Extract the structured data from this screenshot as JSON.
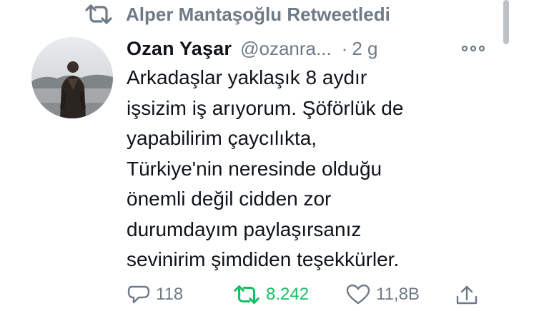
{
  "retweet_context": {
    "label": "Alper Mantaşoğlu Retweetledi"
  },
  "author": {
    "name": "Ozan Yaşar",
    "handle": "@ozanra...",
    "separator": "·",
    "time": "2 g"
  },
  "tweet": {
    "lines": [
      "Arkadaşlar yaklaşık 8 aydır",
      "işsizim iş arıyorum. Şöförlük de",
      "yapabilirim çaycılıkta,",
      "Türkiye'nin neresinde olduğu",
      "önemli değil cidden zor",
      "durumdayım paylaşırsanız",
      "sevinirim şimdiden teşekkürler."
    ]
  },
  "actions": {
    "reply_count": "118",
    "retweet_count": "8.242",
    "like_count": "11,8B"
  },
  "colors": {
    "text": "#0f1419",
    "secondary": "#6e7a86",
    "retweet_active": "#17bf63"
  },
  "icons": {
    "retweet_context": "retweet-icon",
    "more": "more-options-icon",
    "reply": "reply-icon",
    "retweet": "retweet-icon",
    "like": "heart-icon",
    "share": "share-icon"
  }
}
